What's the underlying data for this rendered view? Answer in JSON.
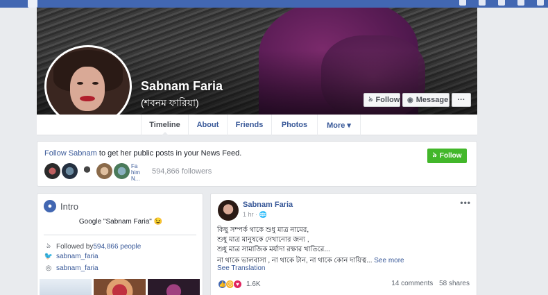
{
  "colors": {
    "brand_blue": "#4267b2",
    "link_blue": "#385898",
    "follow_green": "#42b72a",
    "page_bg": "#e9ebee"
  },
  "profile": {
    "name": "Sabnam Faria",
    "alt_name": "(শবনম ফারিয়া)"
  },
  "cover_actions": {
    "follow_label": "Follow",
    "follow_icon": "rss-icon",
    "message_label": "Message",
    "message_icon": "messenger-icon",
    "more_label": "···"
  },
  "tabs": [
    {
      "label": "Timeline",
      "active": true
    },
    {
      "label": "About"
    },
    {
      "label": "Friends"
    },
    {
      "label": "Photos"
    },
    {
      "label": "More ▾"
    }
  ],
  "follow_card": {
    "text_link": "Follow Sabnam",
    "text_rest": " to get her public posts in your News Feed.",
    "button_label": "Follow",
    "broken_image_text": "Fa him N...",
    "followers_text": "594,866 followers"
  },
  "intro": {
    "title": "Intro",
    "bio": "Google \"Sabnam Faria\" 😉",
    "followed_by_prefix": "Followed by ",
    "followed_by_count": "594,866 people",
    "twitter": "sabnam_faria",
    "instagram": "sabnam_faria"
  },
  "post": {
    "author": "Sabnam Faria",
    "time": "1 hr · ",
    "more": "•••",
    "lines": [
      "কিছু সম্পর্ক থাকে শুধু মাত্র নামের,",
      "শুধু মাত্র মানুষকে দেখানোর জন্য ,",
      "শুধু মাত্র সামাজিক মর্যাদা রক্ষার খাতিরে..."
    ],
    "last_line": "না থাকে ভালবাসা , না থাকে টান, না থাকে কোন দায়িত্ব... ",
    "see_more": "See more",
    "see_translation": "See Translation",
    "reaction_count": "1.6K",
    "comments": "14 comments",
    "shares": "58 shares"
  }
}
